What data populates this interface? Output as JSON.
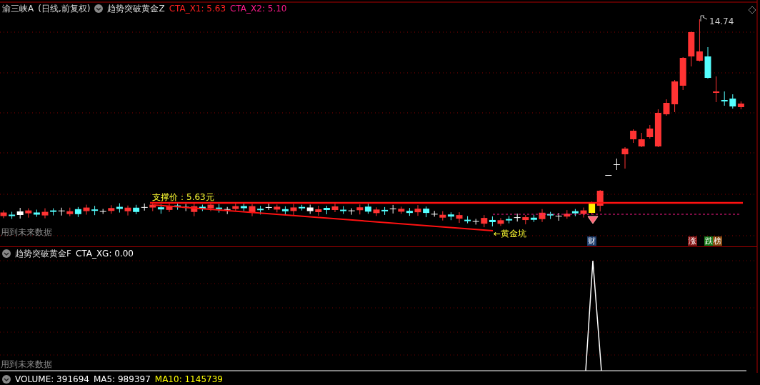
{
  "header": {
    "symbol": "渝三峡A",
    "period": "(日线,前复权)",
    "indicator": "趋势突破黄金Z",
    "values": [
      {
        "label": "CTA_X1: 5.63",
        "color": "#ff2020"
      },
      {
        "label": "CTA_X2: 5.10",
        "color": "#ff1a8c"
      }
    ]
  },
  "price_chart": {
    "support_label": "支撑价：5.63元",
    "high_label": "14.74",
    "pit_label": "←黄金坑",
    "future_warning": "用到未来数据",
    "badges": [
      {
        "label": "财",
        "color": "#1f3f6f"
      },
      {
        "label": "涨",
        "color": "#8b1a1a"
      },
      {
        "label": "跌",
        "color": "#1a7a1a"
      },
      {
        "label": "榜",
        "color": "#8a4a10"
      }
    ]
  },
  "signal_panel": {
    "indicator": "趋势突破黄金F",
    "values": [
      {
        "label": "CTA_XG: 0.00",
        "color": "#ffffff"
      }
    ],
    "future_warning": "用到未来数据"
  },
  "volume_panel": {
    "values": [
      {
        "label": "VOLUME: 391694",
        "color": "#ffffff"
      },
      {
        "label": "MA5: 989397",
        "color": "#ffffff"
      },
      {
        "label": "MA10: 1145739",
        "color": "#ffff00"
      }
    ]
  }
}
